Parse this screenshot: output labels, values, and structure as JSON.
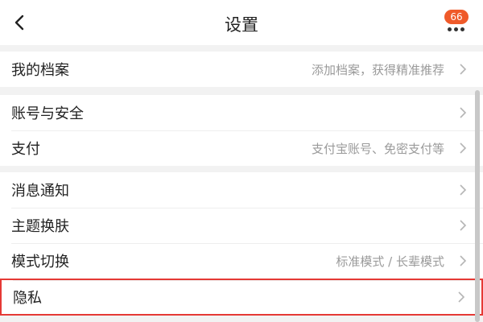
{
  "header": {
    "title": "设置",
    "back_icon": "chevron-left-icon",
    "more_icon": "more-dots-icon",
    "badge_count": "66",
    "badge_color": "#ef5a2a"
  },
  "groups": [
    {
      "items": [
        {
          "label": "我的档案",
          "hint": "添加档案，获得精准推荐"
        }
      ]
    },
    {
      "items": [
        {
          "label": "账号与安全",
          "hint": ""
        },
        {
          "label": "支付",
          "hint": "支付宝账号、免密支付等"
        }
      ]
    },
    {
      "items": [
        {
          "label": "消息通知",
          "hint": ""
        },
        {
          "label": "主题换肤",
          "hint": ""
        },
        {
          "label": "模式切换",
          "hint": "标准模式 / 长辈模式"
        },
        {
          "label": "隐私",
          "hint": ""
        }
      ]
    }
  ],
  "colors": {
    "highlight_border": "#e53935",
    "background": "#f2f2f2"
  }
}
